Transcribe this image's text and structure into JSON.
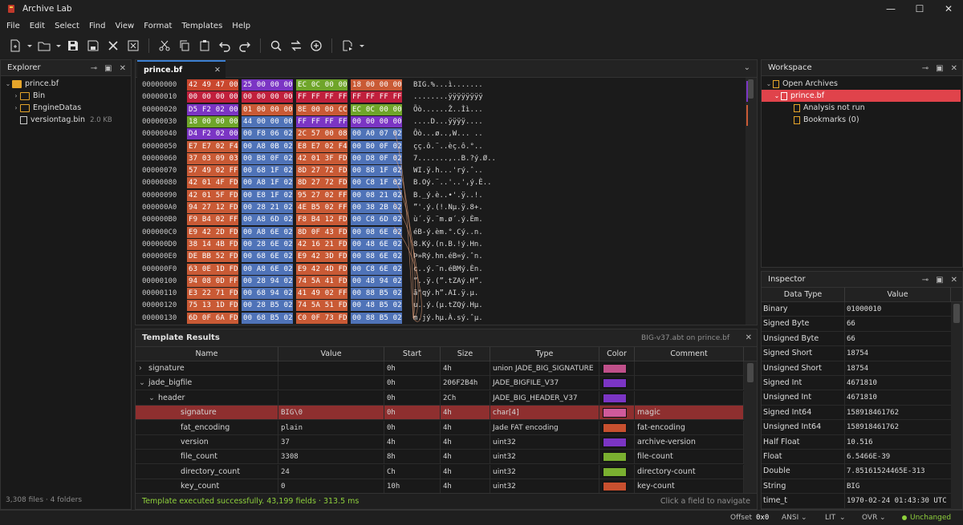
{
  "app": {
    "title": "Archive Lab"
  },
  "menu": [
    "File",
    "Edit",
    "Select",
    "Find",
    "View",
    "Format",
    "Templates",
    "Help"
  ],
  "explorer": {
    "title": "Explorer",
    "root": "prince.bf",
    "items": [
      {
        "label": "Bin",
        "type": "folder"
      },
      {
        "label": "EngineDatas",
        "type": "folder"
      },
      {
        "label": "versiontag.bin",
        "type": "file",
        "size": "2.0 KB"
      }
    ],
    "footer": "3,308 files · 4 folders"
  },
  "hex": {
    "tab": "prince.bf",
    "rows": [
      {
        "off": "00000000",
        "g": [
          "42 49 47 00",
          "25 00 00 00",
          "EC 0C 00 00",
          "18 00 00 00"
        ],
        "c": [
          "red",
          "purple",
          "green",
          "orange"
        ],
        "a": "BIG.%...ì......."
      },
      {
        "off": "00000010",
        "g": [
          "00 00 00 00",
          "00 00 00 00",
          "FF FF FF FF",
          "FF FF FF FF"
        ],
        "c": [
          "crimson",
          "crimson",
          "crimson",
          "crimson"
        ],
        "a": "........ÿÿÿÿÿÿÿÿ"
      },
      {
        "off": "00000020",
        "g": [
          "D5 F2 02 00",
          "01 00 00 00",
          "8E 00 00 CC",
          "EC 0C 00 00"
        ],
        "c": [
          "purple",
          "orange",
          "orange",
          "green"
        ],
        "a": "Õò......Ž..Ìì..."
      },
      {
        "off": "00000030",
        "g": [
          "18 00 00 00",
          "44 00 00 00",
          "FF FF FF FF",
          "00 00 00 00"
        ],
        "c": [
          "green",
          "blue",
          "purple",
          "purple"
        ],
        "a": "....D...ÿÿÿÿ...."
      },
      {
        "off": "00000040",
        "g": [
          "D4 F2 02 00",
          "00 F8 06 02",
          "2C 57 00 08",
          "00 A0 07 02"
        ],
        "c": [
          "purple",
          "blue",
          "orange",
          "blue"
        ],
        "a": "Ôò...ø..,W... .."
      },
      {
        "off": "00000050",
        "g": [
          "E7 E7 02 F4",
          "00 A8 0B 02",
          "E8 E7 02 F4",
          "00 B0 0F 02"
        ],
        "c": [
          "orange",
          "blue",
          "orange",
          "blue"
        ],
        "a": "çç.ô.¨..èç.ô.°.."
      },
      {
        "off": "00000060",
        "g": [
          "37 03 09 03",
          "00 B8 0F 02",
          "42 01 3F FD",
          "00 D8 0F 02"
        ],
        "c": [
          "orange",
          "blue",
          "orange",
          "blue"
        ],
        "a": "7.......,..B.?ý.Ø.."
      },
      {
        "off": "00000070",
        "g": [
          "57 49 02 FF",
          "00 68 1F 02",
          "8D 27 72 FD",
          "00 88 1F 02"
        ],
        "c": [
          "orange",
          "blue",
          "orange",
          "blue"
        ],
        "a": "WI.ÿ.h...'rý.ˆ.."
      },
      {
        "off": "00000080",
        "g": [
          "42 01 4F FD",
          "00 A8 1F 02",
          "8D 27 72 FD",
          "00 C8 1F 02"
        ],
        "c": [
          "orange",
          "blue",
          "orange",
          "blue"
        ],
        "a": "B.Oý.¨..'..',ý.È.."
      },
      {
        "off": "00000090",
        "g": [
          "42 01 5F FD",
          "00 E8 1F 02",
          "95 27 02 FF",
          "00 08 21 02"
        ],
        "c": [
          "orange",
          "blue",
          "orange",
          "blue"
        ],
        "a": "B._ý.è..•'.ÿ..!."
      },
      {
        "off": "000000A0",
        "g": [
          "94 27 12 FD",
          "00 28 21 02",
          "4E B5 02 FF",
          "00 38 2B 02"
        ],
        "c": [
          "orange",
          "blue",
          "orange",
          "blue"
        ],
        "a": "”'.ý.(!.Nµ.ÿ.8+."
      },
      {
        "off": "000000B0",
        "g": [
          "F9 B4 02 FF",
          "00 A8 6D 02",
          "F8 B4 12 FD",
          "00 C8 6D 02"
        ],
        "c": [
          "orange",
          "blue",
          "orange",
          "blue"
        ],
        "a": "ù´.ÿ.¨m.ø´.ý.Èm."
      },
      {
        "off": "000000C0",
        "g": [
          "E9 42 2D FD",
          "00 A8 6E 02",
          "8D 0F 43 FD",
          "00 08 6E 02"
        ],
        "c": [
          "orange",
          "blue",
          "orange",
          "blue"
        ],
        "a": "éB-ý.èm.°.Cý..n."
      },
      {
        "off": "000000D0",
        "g": [
          "38 14 4B FD",
          "00 28 6E 02",
          "42 16 21 FD",
          "00 48 6E 02"
        ],
        "c": [
          "orange",
          "blue",
          "orange",
          "blue"
        ],
        "a": "8.Ký.(n.B.!ý.Hn."
      },
      {
        "off": "000000E0",
        "g": [
          "DE BB 52 FD",
          "00 68 6E 02",
          "E9 42 3D FD",
          "00 88 6E 02"
        ],
        "c": [
          "orange",
          "blue",
          "orange",
          "blue"
        ],
        "a": "Þ»Rý.hn.éB=ý.ˆn."
      },
      {
        "off": "000000F0",
        "g": [
          "63 0E 1D FD",
          "00 A8 6E 02",
          "E9 42 4D FD",
          "00 C8 6E 02"
        ],
        "c": [
          "orange",
          "blue",
          "orange",
          "blue"
        ],
        "a": "c..ý.¨n.éBMý.Èn."
      },
      {
        "off": "00000100",
        "g": [
          "94 08 0D FF",
          "00 28 94 02",
          "74 5A 41 FD",
          "00 48 94 02"
        ],
        "c": [
          "orange",
          "blue",
          "orange",
          "blue"
        ],
        "a": "”..ÿ.(”.tZAý.H”."
      },
      {
        "off": "00000110",
        "g": [
          "E3 22 71 FD",
          "00 68 94 02",
          "41 49 02 FF",
          "00 88 B5 02"
        ],
        "c": [
          "orange",
          "blue",
          "orange",
          "blue"
        ],
        "a": "ã\"qý.h”.AI.ÿ.µ."
      },
      {
        "off": "00000120",
        "g": [
          "75 13 1D FD",
          "00 28 B5 02",
          "74 5A 51 FD",
          "00 48 B5 02"
        ],
        "c": [
          "orange",
          "blue",
          "orange",
          "blue"
        ],
        "a": "u..ý.(µ.tZQý.Hµ."
      },
      {
        "off": "00000130",
        "g": [
          "6D 0F 6A FD",
          "00 68 B5 02",
          "C0 0F 73 FD",
          "00 88 B5 02"
        ],
        "c": [
          "orange",
          "blue",
          "orange",
          "blue"
        ],
        "a": "m.jý.hµ.À.sý.ˆµ."
      }
    ]
  },
  "template": {
    "title": "Template Results",
    "source": "BIG-v37.abt on prince.bf",
    "columns": [
      "Name",
      "Value",
      "Start",
      "Size",
      "Type",
      "Color",
      "Comment"
    ],
    "rows": [
      {
        "indent": 0,
        "caret": "›",
        "name": "signature",
        "value": "",
        "start": "0h",
        "size": "4h",
        "type": "union JADE_BIG_SIGNATURE",
        "color": "#c0508a",
        "comment": ""
      },
      {
        "indent": 0,
        "caret": "⌄",
        "name": "jade_bigfile",
        "value": "",
        "start": "0h",
        "size": "206F2B4h",
        "type": "JADE_BIGFILE_V37",
        "color": "#7b35c4",
        "comment": ""
      },
      {
        "indent": 1,
        "caret": "⌄",
        "name": "header",
        "value": "",
        "start": "0h",
        "size": "2Ch",
        "type": "JADE_BIG_HEADER_V37",
        "color": "#7b35c4",
        "comment": ""
      },
      {
        "indent": 2,
        "caret": "",
        "name": "signature",
        "value": "BIG\\0",
        "start": "0h",
        "size": "4h",
        "type": "char[4]",
        "color": "#d05a9a",
        "comment": "magic",
        "selected": true
      },
      {
        "indent": 2,
        "caret": "",
        "name": "fat_encoding",
        "value": "plain",
        "start": "0h",
        "size": "4h",
        "type": "Jade FAT encoding",
        "color": "#c8502f",
        "comment": "fat-encoding"
      },
      {
        "indent": 2,
        "caret": "",
        "name": "version",
        "value": "37",
        "start": "4h",
        "size": "4h",
        "type": "uint32",
        "color": "#7b35c4",
        "comment": "archive-version"
      },
      {
        "indent": 2,
        "caret": "",
        "name": "file_count",
        "value": "3308",
        "start": "8h",
        "size": "4h",
        "type": "uint32",
        "color": "#7ab030",
        "comment": "file-count"
      },
      {
        "indent": 2,
        "caret": "",
        "name": "directory_count",
        "value": "24",
        "start": "Ch",
        "size": "4h",
        "type": "uint32",
        "color": "#7ab030",
        "comment": "directory-count"
      },
      {
        "indent": 2,
        "caret": "",
        "name": "key_count",
        "value": "0",
        "start": "10h",
        "size": "4h",
        "type": "uint32",
        "color": "#c8502f",
        "comment": "key-count"
      }
    ],
    "status": "Template executed successfully. 43,199 fields · 313.5 ms",
    "hint": "Click a field to navigate"
  },
  "workspace": {
    "title": "Workspace",
    "group": "Open Archives",
    "file": "prince.bf",
    "children": [
      "Analysis not run",
      "Bookmarks (0)"
    ]
  },
  "inspector": {
    "title": "Inspector",
    "columns": [
      "Data Type",
      "Value"
    ],
    "rows": [
      [
        "Binary",
        "01000010"
      ],
      [
        "Signed Byte",
        "66"
      ],
      [
        "Unsigned Byte",
        "66"
      ],
      [
        "Signed Short",
        "18754"
      ],
      [
        "Unsigned Short",
        "18754"
      ],
      [
        "Signed Int",
        "4671810"
      ],
      [
        "Unsigned Int",
        "4671810"
      ],
      [
        "Signed Int64",
        "158918461762"
      ],
      [
        "Unsigned Int64",
        "158918461762"
      ],
      [
        "Half Float",
        "10.516"
      ],
      [
        "Float",
        "6.5466E-39"
      ],
      [
        "Double",
        "7.85161524465E-313"
      ],
      [
        "String",
        "BIG"
      ],
      [
        "time_t",
        "1970-02-24 01:43:30 UTC"
      ]
    ]
  },
  "status": {
    "offset_label": "Offset",
    "offset_value": "0x0",
    "encoding": "ANSI",
    "endian": "LIT",
    "mode": "OVR",
    "state": "Unchanged"
  },
  "colors": {
    "red": "#c9472e",
    "crimson": "#c01f3c",
    "purple": "#7b35c4",
    "green": "#6fa52a",
    "orange": "#c95a35",
    "blue": "#4f73b8",
    "selected_row": "#8e2f2f",
    "workspace_sel": "#e0434b",
    "success": "#8fd13c"
  }
}
